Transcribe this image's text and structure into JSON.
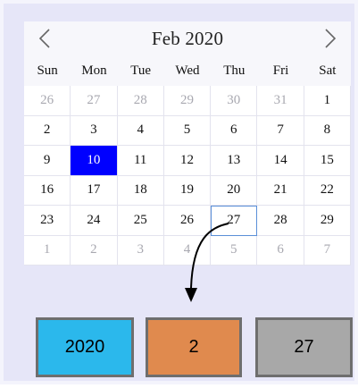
{
  "calendar": {
    "title": "Feb 2020",
    "prev_icon": "chevron-left-icon",
    "next_icon": "chevron-right-icon",
    "weekdays": [
      "Sun",
      "Mon",
      "Tue",
      "Wed",
      "Thu",
      "Fri",
      "Sat"
    ],
    "weeks": [
      [
        {
          "d": "26",
          "other": true
        },
        {
          "d": "27",
          "other": true
        },
        {
          "d": "28",
          "other": true
        },
        {
          "d": "29",
          "other": true
        },
        {
          "d": "30",
          "other": true
        },
        {
          "d": "31",
          "other": true
        },
        {
          "d": "1"
        }
      ],
      [
        {
          "d": "2"
        },
        {
          "d": "3"
        },
        {
          "d": "4"
        },
        {
          "d": "5"
        },
        {
          "d": "6"
        },
        {
          "d": "7"
        },
        {
          "d": "8"
        }
      ],
      [
        {
          "d": "9"
        },
        {
          "d": "10",
          "selected": true
        },
        {
          "d": "11"
        },
        {
          "d": "12"
        },
        {
          "d": "13"
        },
        {
          "d": "14"
        },
        {
          "d": "15"
        }
      ],
      [
        {
          "d": "16"
        },
        {
          "d": "17"
        },
        {
          "d": "18"
        },
        {
          "d": "19"
        },
        {
          "d": "20"
        },
        {
          "d": "21"
        },
        {
          "d": "22"
        }
      ],
      [
        {
          "d": "23"
        },
        {
          "d": "24"
        },
        {
          "d": "25"
        },
        {
          "d": "26"
        },
        {
          "d": "27",
          "focused": true
        },
        {
          "d": "28"
        },
        {
          "d": "29"
        }
      ],
      [
        {
          "d": "1",
          "other": true
        },
        {
          "d": "2",
          "other": true
        },
        {
          "d": "3",
          "other": true
        },
        {
          "d": "4",
          "other": true
        },
        {
          "d": "5",
          "other": true
        },
        {
          "d": "6",
          "other": true
        },
        {
          "d": "7",
          "other": true
        }
      ]
    ],
    "colors": {
      "selected": "#0000ff",
      "focus_outline": "#5a8fd8"
    }
  },
  "outputs": {
    "year": "2020",
    "month": "2",
    "day": "27",
    "colors": {
      "year": "#2bb8ec",
      "month": "#e08a4e",
      "day": "#a8a8a8"
    }
  }
}
